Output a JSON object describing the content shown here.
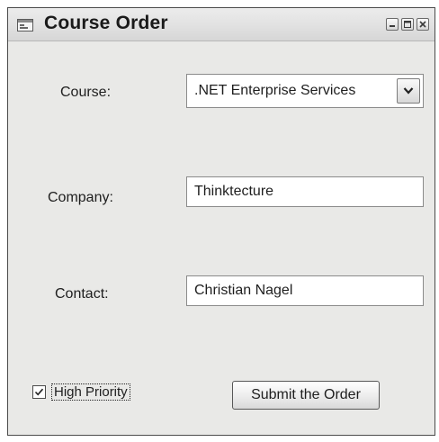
{
  "window": {
    "title": "Course Order",
    "icon": "form-icon",
    "controls": [
      "minimize-icon",
      "maximize-icon",
      "close-icon"
    ]
  },
  "form": {
    "course": {
      "label": "Course:",
      "selected": ".NET Enterprise Services"
    },
    "company": {
      "label": "Company:",
      "value": "Thinktecture"
    },
    "contact": {
      "label": "Contact:",
      "value": "Christian Nagel"
    },
    "priority": {
      "label": "High Priority",
      "checked": true
    },
    "submit_label": "Submit the Order"
  },
  "colors": {
    "window_background": "#e9e9e7",
    "border": "#4b4b4b"
  }
}
